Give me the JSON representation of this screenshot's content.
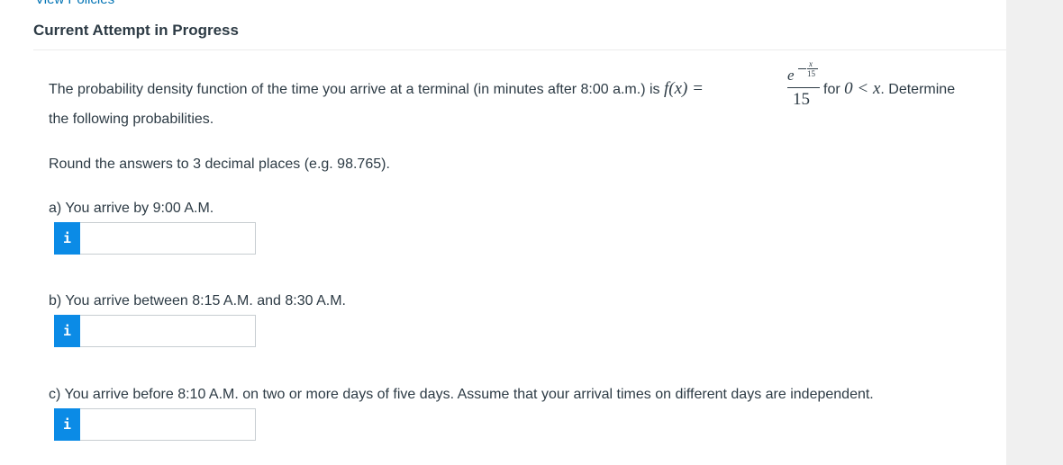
{
  "header": {
    "view_policies": "View Policies",
    "attempt_status": "Current Attempt in Progress"
  },
  "question": {
    "pdf_text": "The probability density function of the time you arrive at a terminal (in minutes after 8:00 a.m.) is",
    "fx": "f(x) =",
    "fraction": {
      "base": "e",
      "exp_numerator": "x",
      "exp_denominator": "15",
      "denominator": "15"
    },
    "for_text": "for",
    "condition": "0 < x",
    "after_condition": ". Determine",
    "continuation": "the following probabilities.",
    "rounding": "Round the answers to 3 decimal places (e.g. 98.765)."
  },
  "parts": [
    {
      "label": "a) You arrive by 9:00 A.M.",
      "value": ""
    },
    {
      "label": "b) You arrive between 8:15 A.M. and 8:30 A.M.",
      "value": ""
    },
    {
      "label": "c) You arrive before 8:10 A.M. on two or more days of five days. Assume that your arrival times on different days are independent.",
      "value": ""
    }
  ],
  "info_icon_glyph": "i",
  "colors": {
    "link": "#0374b5",
    "info_button": "#0b8be6",
    "text": "#2d3b45"
  }
}
